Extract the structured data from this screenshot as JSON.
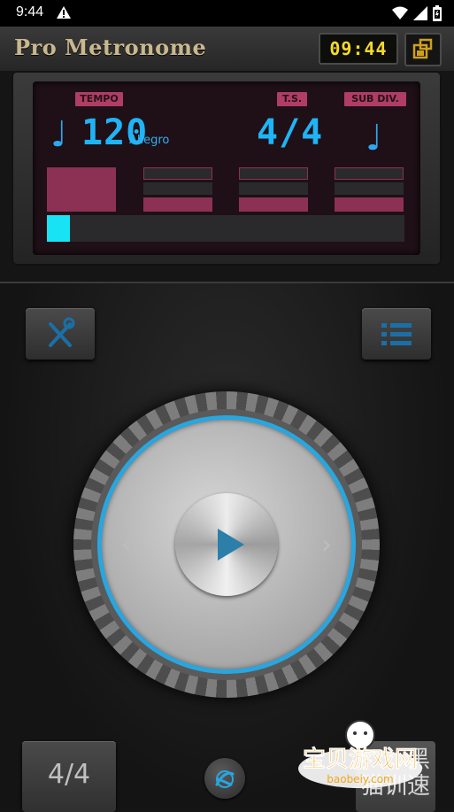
{
  "status_bar": {
    "time": "9:44"
  },
  "header": {
    "app_title": "Pro Metronome",
    "clock": "09:44"
  },
  "display": {
    "tempo_label": "TEMPO",
    "tempo_value": "120",
    "tempo_name": "Allegro",
    "ts_label": "T.S.",
    "ts_value": "4/4",
    "subdiv_label": "SUB DIV.",
    "beats": [
      {
        "accent": true
      },
      {
        "accent": false
      },
      {
        "accent": false
      },
      {
        "accent": false
      }
    ],
    "progress_fraction": 0.065
  },
  "controls": {
    "time_signature_button": "4/4",
    "right_button_text": "黑\n猫训速"
  },
  "watermark": {
    "title": "宝贝游戏网",
    "url": "baobeiy.com"
  },
  "colors": {
    "lcd_accent": "#b03d64",
    "lcd_blue": "#1fb4f6",
    "progress": "#17e3f5",
    "ring_blue": "#29a6df",
    "clock_yellow": "#f4d92a"
  },
  "icons": [
    "warning-icon",
    "wifi-icon",
    "signal-icon",
    "battery-icon",
    "lock-rotate-icon",
    "note-icon",
    "tools-icon",
    "list-icon",
    "play-icon",
    "chevron-left-icon",
    "chevron-right-icon",
    "tap-icon"
  ]
}
